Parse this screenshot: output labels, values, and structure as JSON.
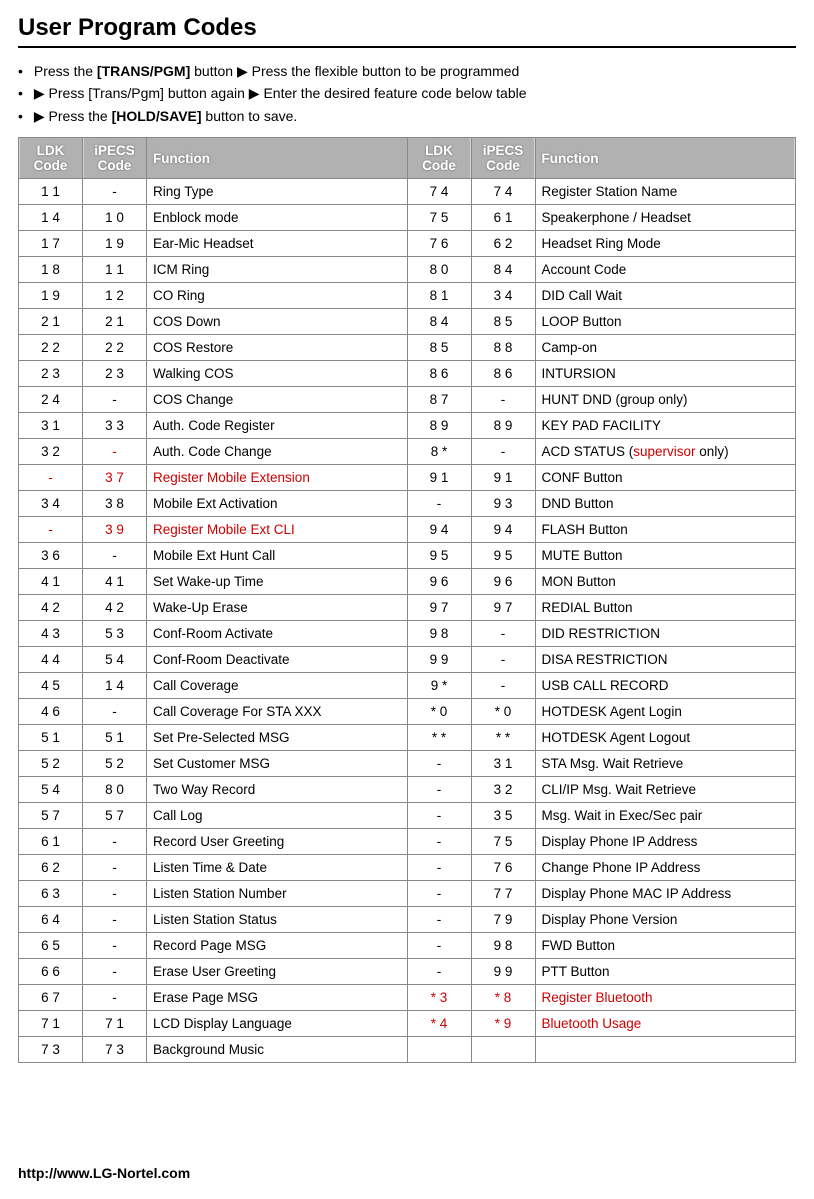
{
  "title": "User Program Codes",
  "instructions": {
    "line1_prefix": "Press the ",
    "line1_bold": "[TRANS/PGM]",
    "line1_mid": " button  ▶   Press the flexible button to be programmed",
    "line2": "▶   Press [Trans/Pgm] button again  ▶ Enter the desired feature code below table",
    "line3_prefix": "▶   Press the ",
    "line3_bold": "[HOLD/SAVE]",
    "line3_suffix": " button to save."
  },
  "headers": {
    "ldk": "LDK Code",
    "ipecs": "iPECS Code",
    "func": "Function"
  },
  "rows": [
    {
      "l_ldk": "1 1",
      "l_ipecs": "-",
      "l_func": "Ring Type",
      "r_ldk": "7 4",
      "r_ipecs": "7 4",
      "r_func": "Register Station Name"
    },
    {
      "l_ldk": "1 4",
      "l_ipecs": "1 0",
      "l_func": "Enblock mode",
      "r_ldk": "7 5",
      "r_ipecs": "6 1",
      "r_func": "Speakerphone / Headset"
    },
    {
      "l_ldk": "1 7",
      "l_ipecs": "1 9",
      "l_func": "Ear-Mic Headset",
      "r_ldk": "7 6",
      "r_ipecs": "6 2",
      "r_func": "Headset Ring Mode"
    },
    {
      "l_ldk": "1 8",
      "l_ipecs": "1 1",
      "l_func": "ICM Ring",
      "r_ldk": "8 0",
      "r_ipecs": "8 4",
      "r_func": "Account Code"
    },
    {
      "l_ldk": "1 9",
      "l_ipecs": "1 2",
      "l_func": "CO Ring",
      "r_ldk": "8 1",
      "r_ipecs": "3 4",
      "r_func": "DID Call Wait"
    },
    {
      "l_ldk": "2 1",
      "l_ipecs": "2 1",
      "l_func": "COS Down",
      "r_ldk": "8 4",
      "r_ipecs": "8 5",
      "r_func": "LOOP Button"
    },
    {
      "l_ldk": "2 2",
      "l_ipecs": "2 2",
      "l_func": "COS Restore",
      "r_ldk": "8 5",
      "r_ipecs": "8 8",
      "r_func": "Camp-on"
    },
    {
      "l_ldk": "2 3",
      "l_ipecs": "2 3",
      "l_func": "Walking COS",
      "r_ldk": "8 6",
      "r_ipecs": "8 6",
      "r_func": "INTURSION"
    },
    {
      "l_ldk": "2 4",
      "l_ipecs": "-",
      "l_func": "COS Change",
      "r_ldk": "8 7",
      "r_ipecs": "-",
      "r_func": "HUNT DND (group only)"
    },
    {
      "l_ldk": "3 1",
      "l_ipecs": "3 3",
      "l_func": "Auth. Code Register",
      "r_ldk": "8 9",
      "r_ipecs": "8 9",
      "r_func": "KEY PAD FACILITY"
    },
    {
      "l_ldk": "3 2",
      "l_ipecs": "-",
      "l_ipecs_red": true,
      "l_func": "Auth. Code Change",
      "r_ldk": "8 *",
      "r_ipecs": "-",
      "r_func_pre": "ACD STATUS (",
      "r_func_red": "supervisor",
      "r_func_post": " only)"
    },
    {
      "l_ldk": "-",
      "l_ldk_red": true,
      "l_ipecs": "3 7",
      "l_ipecs_red": true,
      "l_func": "Register Mobile Extension",
      "l_func_red": true,
      "r_ldk": "9 1",
      "r_ipecs": "9 1",
      "r_func": "CONF Button"
    },
    {
      "l_ldk": "3 4",
      "l_ipecs": "3 8",
      "l_func": "Mobile Ext Activation",
      "r_ldk": "-",
      "r_ipecs": "9 3",
      "r_func": "DND Button"
    },
    {
      "l_ldk": "-",
      "l_ldk_red": true,
      "l_ipecs": "3 9",
      "l_ipecs_red": true,
      "l_func": "Register Mobile Ext CLI",
      "l_func_red": true,
      "r_ldk": "9 4",
      "r_ipecs": "9 4",
      "r_func": "FLASH Button"
    },
    {
      "l_ldk": "3 6",
      "l_ipecs": "-",
      "l_func": "Mobile Ext Hunt Call",
      "r_ldk": "9 5",
      "r_ipecs": "9 5",
      "r_func": "MUTE Button"
    },
    {
      "l_ldk": "4 1",
      "l_ipecs": "4 1",
      "l_func": "Set Wake-up Time",
      "r_ldk": "9 6",
      "r_ipecs": "9 6",
      "r_func": "MON Button"
    },
    {
      "l_ldk": "4 2",
      "l_ipecs": "4 2",
      "l_func": "Wake-Up Erase",
      "r_ldk": "9 7",
      "r_ipecs": "9 7",
      "r_func": "REDIAL Button"
    },
    {
      "l_ldk": "4 3",
      "l_ipecs": "5 3",
      "l_func": "Conf-Room Activate",
      "r_ldk": "9 8",
      "r_ipecs": "-",
      "r_func": "DID RESTRICTION"
    },
    {
      "l_ldk": "4 4",
      "l_ipecs": "5 4",
      "l_func": "Conf-Room Deactivate",
      "r_ldk": "9 9",
      "r_ipecs": "-",
      "r_func": "DISA RESTRICTION"
    },
    {
      "l_ldk": "4 5",
      "l_ipecs": "1 4",
      "l_func": "Call Coverage",
      "r_ldk": "9 *",
      "r_ipecs": "-",
      "r_func": "USB CALL RECORD"
    },
    {
      "l_ldk": "4 6",
      "l_ipecs": "-",
      "l_func": "Call Coverage For STA XXX",
      "r_ldk": "* 0",
      "r_ipecs": "* 0",
      "r_func": "HOTDESK Agent Login"
    },
    {
      "l_ldk": "5 1",
      "l_ipecs": "5 1",
      "l_func": "Set Pre-Selected MSG",
      "r_ldk": "* *",
      "r_ipecs": "* *",
      "r_func": "HOTDESK Agent Logout"
    },
    {
      "l_ldk": "5 2",
      "l_ipecs": "5 2",
      "l_func": "Set Customer MSG",
      "r_ldk": "-",
      "r_ipecs": "3 1",
      "r_func": "STA Msg. Wait Retrieve"
    },
    {
      "l_ldk": "5 4",
      "l_ipecs": "8 0",
      "l_func": "Two Way Record",
      "r_ldk": "-",
      "r_ipecs": "3 2",
      "r_func": "CLI/IP Msg. Wait Retrieve"
    },
    {
      "l_ldk": "5 7",
      "l_ipecs": "5 7",
      "l_func": "Call Log",
      "r_ldk": "-",
      "r_ipecs": "3 5",
      "r_func": "Msg. Wait in Exec/Sec pair"
    },
    {
      "l_ldk": "6 1",
      "l_ipecs": "-",
      "l_func": "Record User Greeting",
      "r_ldk": "-",
      "r_ipecs": "7 5",
      "r_func": "Display Phone IP Address"
    },
    {
      "l_ldk": "6 2",
      "l_ipecs": "-",
      "l_func": "Listen Time & Date",
      "r_ldk": "-",
      "r_ipecs": "7 6",
      "r_func": "Change Phone IP Address"
    },
    {
      "l_ldk": "6 3",
      "l_ipecs": "-",
      "l_func": "Listen Station Number",
      "r_ldk": "-",
      "r_ipecs": "7 7",
      "r_func": "Display Phone MAC IP Address"
    },
    {
      "l_ldk": "6 4",
      "l_ipecs": "-",
      "l_func": "Listen Station Status",
      "r_ldk": "-",
      "r_ipecs": "7 9",
      "r_func": "Display Phone Version"
    },
    {
      "l_ldk": "6 5",
      "l_ipecs": "-",
      "l_func": "Record Page MSG",
      "r_ldk": "-",
      "r_ipecs": "9 8",
      "r_func": "FWD Button"
    },
    {
      "l_ldk": "6 6",
      "l_ipecs": "-",
      "l_func": "Erase User Greeting",
      "r_ldk": "-",
      "r_ipecs": "9 9",
      "r_func": "PTT Button"
    },
    {
      "l_ldk": "6 7",
      "l_ipecs": "-",
      "l_func": "Erase Page MSG",
      "r_ldk": "* 3",
      "r_ldk_red": true,
      "r_ipecs": "* 8",
      "r_ipecs_red": true,
      "r_func": "Register Bluetooth",
      "r_func_red": true
    },
    {
      "l_ldk": "7 1",
      "l_ipecs": "7 1",
      "l_func": "LCD Display Language",
      "r_ldk": "* 4",
      "r_ldk_red": true,
      "r_ipecs": "* 9",
      "r_ipecs_red": true,
      "r_func": "Bluetooth Usage",
      "r_func_red": true
    },
    {
      "l_ldk": "7 3",
      "l_ipecs": "7 3",
      "l_func": "Background Music",
      "r_ldk": "",
      "r_ipecs": "",
      "r_func": ""
    }
  ],
  "footer": "http://www.LG-Nortel.com"
}
